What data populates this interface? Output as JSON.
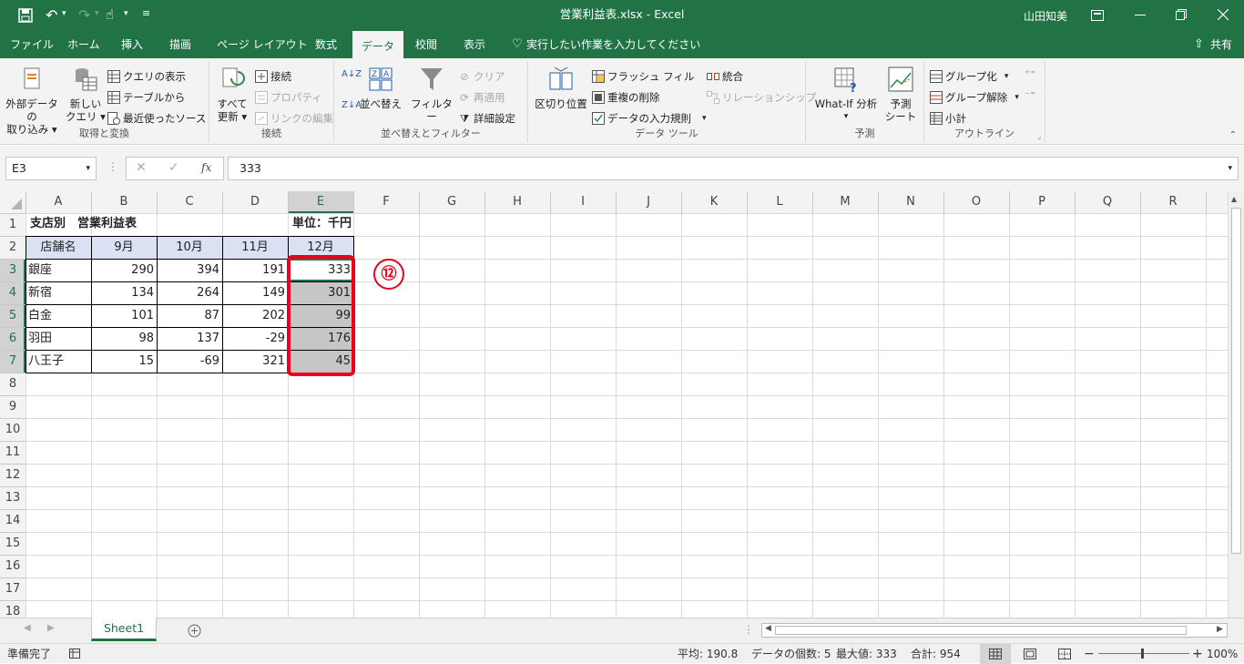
{
  "window": {
    "title": "営業利益表.xlsx  -  Excel",
    "user": "山田知美"
  },
  "tabs": [
    "ファイル",
    "ホーム",
    "挿入",
    "描画",
    "ページ レイアウト",
    "数式",
    "データ",
    "校閲",
    "表示"
  ],
  "tell_me": "実行したい作業を入力してください",
  "share": "共有",
  "ribbon": {
    "get_transform": {
      "external_data": [
        "外部データの",
        "取り込み"
      ],
      "new_query": [
        "新しい",
        "クエリ"
      ],
      "show_queries": "クエリの表示",
      "from_table": "テーブルから",
      "recent_sources": "最近使ったソース",
      "label": "取得と変換"
    },
    "connections": {
      "refresh_all": [
        "すべて",
        "更新"
      ],
      "connections": "接続",
      "properties": "プロパティ",
      "edit_links": "リンクの編集",
      "label": "接続"
    },
    "sort_filter": {
      "sort": "並べ替え",
      "filter": "フィルター",
      "clear": "クリア",
      "reapply": "再適用",
      "advanced": "詳細設定",
      "label": "並べ替えとフィルター"
    },
    "data_tools": {
      "text_to_columns": "区切り位置",
      "flash_fill": "フラッシュ フィル",
      "remove_duplicates": "重複の削除",
      "data_validation": "データの入力規則",
      "consolidate": "統合",
      "relationships": "リレーションシップ",
      "label": "データ ツール"
    },
    "forecast": {
      "what_if": [
        "What-If 分析",
        ""
      ],
      "forecast_sheet": [
        "予測",
        "シート"
      ],
      "label": "予測"
    },
    "outline": {
      "group": "グループ化",
      "ungroup": "グループ解除",
      "subtotal": "小計",
      "label": "アウトライン"
    }
  },
  "formula_bar": {
    "name_box": "E3",
    "formula": "333"
  },
  "columns": [
    "A",
    "B",
    "C",
    "D",
    "E",
    "F",
    "G",
    "H",
    "I",
    "J",
    "K",
    "L",
    "M",
    "N",
    "O",
    "P",
    "Q",
    "R"
  ],
  "rows": [
    "1",
    "2",
    "3",
    "4",
    "5",
    "6",
    "7",
    "8",
    "9",
    "10",
    "11",
    "12",
    "13",
    "14",
    "15",
    "16",
    "17",
    "18"
  ],
  "sheet": {
    "title": "支店別　営業利益表",
    "unit": "単位：千円",
    "headers": [
      "店舗名",
      "9月",
      "10月",
      "11月",
      "12月"
    ],
    "data": [
      [
        "銀座",
        "290",
        "394",
        "191",
        "333"
      ],
      [
        "新宿",
        "134",
        "264",
        "149",
        "301"
      ],
      [
        "白金",
        "101",
        "87",
        "202",
        "99"
      ],
      [
        "羽田",
        "98",
        "137",
        "-29",
        "176"
      ],
      [
        "八王子",
        "15",
        "-69",
        "321",
        "45"
      ]
    ]
  },
  "annotation": "⑫",
  "sheet_tab": "Sheet1",
  "status": {
    "ready": "準備完了",
    "average": "平均: 190.8",
    "count": "データの個数: 5",
    "max": "最大値: 333",
    "sum": "合計: 954",
    "zoom": "100%"
  },
  "colors": {
    "excel_green": "#217346",
    "header_fill": "#d9e1f2",
    "selection_fill": "#c6c6c6",
    "highlight_red": "#e8001c"
  }
}
